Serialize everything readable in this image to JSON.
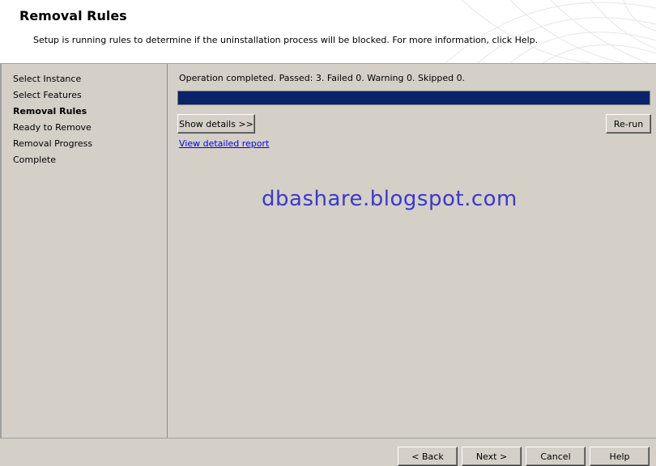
{
  "header": {
    "title": "Removal Rules",
    "subtitle": "Setup is running rules to determine if the uninstallation process will be blocked. For more information, click Help."
  },
  "nav": {
    "items": [
      {
        "label": "Select Instance",
        "active": false
      },
      {
        "label": "Select Features",
        "active": false
      },
      {
        "label": "Removal Rules",
        "active": true
      },
      {
        "label": "Ready to Remove",
        "active": false
      },
      {
        "label": "Removal Progress",
        "active": false
      },
      {
        "label": "Complete",
        "active": false
      }
    ]
  },
  "main": {
    "status": "Operation completed. Passed: 3.   Failed 0.   Warning 0.   Skipped 0.",
    "progress_percent": 100,
    "show_details_label": "Show details >>",
    "rerun_label": "Re-run",
    "report_link": "View detailed report",
    "watermark": "dbashare.blogspot.com"
  },
  "footer": {
    "back_label": "< Back",
    "next_label": "Next >",
    "cancel_label": "Cancel",
    "help_label": "Help"
  },
  "colors": {
    "progress_fill": "#0a246a",
    "link": "#0000ee",
    "watermark": "#3a3ac8"
  }
}
